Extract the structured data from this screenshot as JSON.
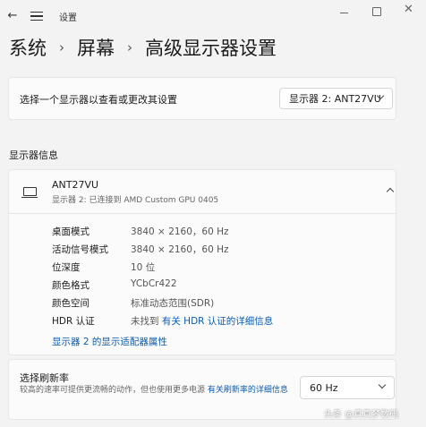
{
  "titlebar": {
    "back_glyph": "←",
    "title": "设置",
    "close_glyph": "✕"
  },
  "breadcrumb": {
    "items": [
      "系统",
      "屏幕",
      "高级显示器设置"
    ],
    "separator": "›"
  },
  "display_select": {
    "label": "选择一个显示器以查看或更改其设置",
    "value": "显示器 2: ANT27VU"
  },
  "display_info": {
    "section_title": "显示器信息",
    "monitor_name": "ANT27VU",
    "monitor_subtitle": "显示器 2: 已连接到 AMD Custom GPU 0405",
    "rows": [
      {
        "label": "桌面模式",
        "value": "3840 × 2160，60 Hz"
      },
      {
        "label": "活动信号模式",
        "value": "3840 × 2160，60 Hz"
      },
      {
        "label": "位深度",
        "value": "10 位"
      },
      {
        "label": "颜色格式",
        "value": "YCbCr422"
      },
      {
        "label": "颜色空间",
        "value": "标准动态范围(SDR)"
      }
    ],
    "hdr": {
      "label": "HDR 认证",
      "value_prefix": "未找到",
      "link": "有关 HDR 认证的详细信息"
    },
    "adapter_link": "显示器 2 的显示适配器属性"
  },
  "refresh_rate": {
    "title": "选择刷新率",
    "description_prefix": "较高的速率可提供更流畅的动作，但也使用更多电源",
    "link": "有关刷新率的详细信息",
    "value": "60 Hz"
  },
  "watermark": "头条 @真真梦数码",
  "icons": {
    "back": "back-arrow-icon",
    "menu": "hamburger-menu-icon",
    "monitor": "monitor-icon",
    "expand": "chevron-up-icon",
    "dropdown": "chevron-down-icon"
  },
  "colors": {
    "background": "#f3f3f3",
    "card": "#fbfbfb",
    "link": "#0b5cad"
  }
}
